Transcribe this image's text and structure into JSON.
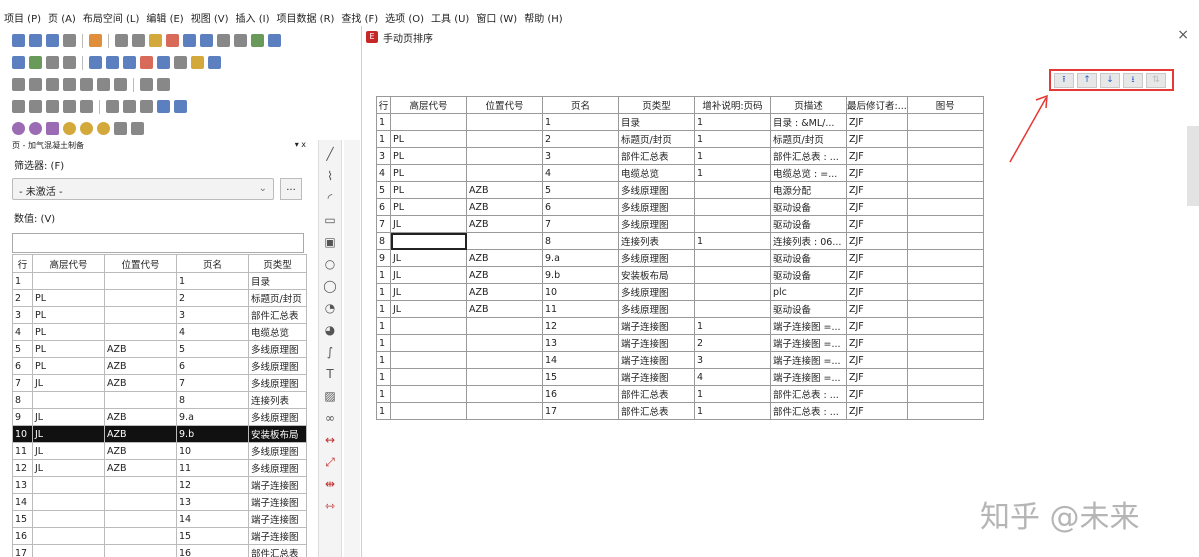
{
  "menubar": [
    "项目 (P)",
    "页 (A)",
    "布局空间 (L)",
    "编辑 (E)",
    "视图 (V)",
    "插入 (I)",
    "项目数据 (R)",
    "查找 (F)",
    "选项 (O)",
    "工具 (U)",
    "窗口 (W)",
    "帮助 (H)"
  ],
  "left_panel": {
    "title": "页 - 加气混凝土制备",
    "pin": "▾ x",
    "filter_label": "筛选器: (F)",
    "filter_value": "- 未激活 -",
    "filter_button": "...",
    "value_label": "数值: (V)",
    "columns": [
      "行",
      "高层代号",
      "位置代号",
      "页名",
      "页类型"
    ],
    "rows": [
      [
        "1",
        "",
        "",
        "1",
        "目录"
      ],
      [
        "2",
        "PL",
        "",
        "2",
        "标题页/封页"
      ],
      [
        "3",
        "PL",
        "",
        "3",
        "部件汇总表"
      ],
      [
        "4",
        "PL",
        "",
        "4",
        "电缆总览"
      ],
      [
        "5",
        "PL",
        "AZB",
        "5",
        "多线原理图"
      ],
      [
        "6",
        "PL",
        "AZB",
        "6",
        "多线原理图"
      ],
      [
        "7",
        "JL",
        "AZB",
        "7",
        "多线原理图"
      ],
      [
        "8",
        "",
        "",
        "8",
        "连接列表"
      ],
      [
        "9",
        "JL",
        "AZB",
        "9.a",
        "多线原理图"
      ],
      [
        "10",
        "JL",
        "AZB",
        "9.b",
        "安装板布局"
      ],
      [
        "11",
        "JL",
        "AZB",
        "10",
        "多线原理图"
      ],
      [
        "12",
        "JL",
        "AZB",
        "11",
        "多线原理图"
      ],
      [
        "13",
        "",
        "",
        "12",
        "端子连接图"
      ],
      [
        "14",
        "",
        "",
        "13",
        "端子连接图"
      ],
      [
        "15",
        "",
        "",
        "14",
        "端子连接图"
      ],
      [
        "16",
        "",
        "",
        "15",
        "端子连接图"
      ],
      [
        "17",
        "",
        "",
        "16",
        "部件汇总表"
      ]
    ],
    "selected_row": 9
  },
  "dialog": {
    "title": "手动页排序",
    "close": "×",
    "sort_buttons": [
      "⭱",
      "↑",
      "↓",
      "⭳",
      "⇅"
    ],
    "columns": [
      "行",
      "高层代号",
      "位置代号",
      "页名",
      "页类型",
      "增补说明:页码",
      "页描述",
      "最后修订者:...",
      "图号"
    ],
    "rows": [
      [
        "1",
        "",
        "",
        "1",
        "目录",
        "1",
        "目录 : &ML/...",
        "ZJF",
        ""
      ],
      [
        "1",
        "PL",
        "",
        "2",
        "标题页/封页",
        "1",
        "标题页/封页",
        "ZJF",
        ""
      ],
      [
        "3",
        "PL",
        "",
        "3",
        "部件汇总表",
        "1",
        "部件汇总表 : ...",
        "ZJF",
        ""
      ],
      [
        "4",
        "PL",
        "",
        "4",
        "电缆总览",
        "1",
        "电缆总览 : =...",
        "ZJF",
        ""
      ],
      [
        "5",
        "PL",
        "AZB",
        "5",
        "多线原理图",
        "",
        "电源分配",
        "ZJF",
        ""
      ],
      [
        "6",
        "PL",
        "AZB",
        "6",
        "多线原理图",
        "",
        "驱动设备",
        "ZJF",
        ""
      ],
      [
        "7",
        "JL",
        "AZB",
        "7",
        "多线原理图",
        "",
        "驱动设备",
        "ZJF",
        ""
      ],
      [
        "8",
        "",
        "",
        "8",
        "连接列表",
        "1",
        "连接列表 : 06...",
        "ZJF",
        ""
      ],
      [
        "9",
        "JL",
        "AZB",
        "9.a",
        "多线原理图",
        "",
        "驱动设备",
        "ZJF",
        ""
      ],
      [
        "1",
        "JL",
        "AZB",
        "9.b",
        "安装板布局",
        "",
        "驱动设备",
        "ZJF",
        ""
      ],
      [
        "1",
        "JL",
        "AZB",
        "10",
        "多线原理图",
        "",
        "plc",
        "ZJF",
        ""
      ],
      [
        "1",
        "JL",
        "AZB",
        "11",
        "多线原理图",
        "",
        "驱动设备",
        "ZJF",
        ""
      ],
      [
        "1",
        "",
        "",
        "12",
        "端子连接图",
        "1",
        "端子连接图 =...",
        "ZJF",
        ""
      ],
      [
        "1",
        "",
        "",
        "13",
        "端子连接图",
        "2",
        "端子连接图 =...",
        "ZJF",
        ""
      ],
      [
        "1",
        "",
        "",
        "14",
        "端子连接图",
        "3",
        "端子连接图 =...",
        "ZJF",
        ""
      ],
      [
        "1",
        "",
        "",
        "15",
        "端子连接图",
        "4",
        "端子连接图 =...",
        "ZJF",
        ""
      ],
      [
        "1",
        "",
        "",
        "16",
        "部件汇总表",
        "1",
        "部件汇总表 : ...",
        "ZJF",
        ""
      ],
      [
        "1",
        "",
        "",
        "17",
        "部件汇总表",
        "1",
        "部件汇总表 : ...",
        "ZJF",
        ""
      ]
    ]
  },
  "watermark": "知乎 @未来"
}
